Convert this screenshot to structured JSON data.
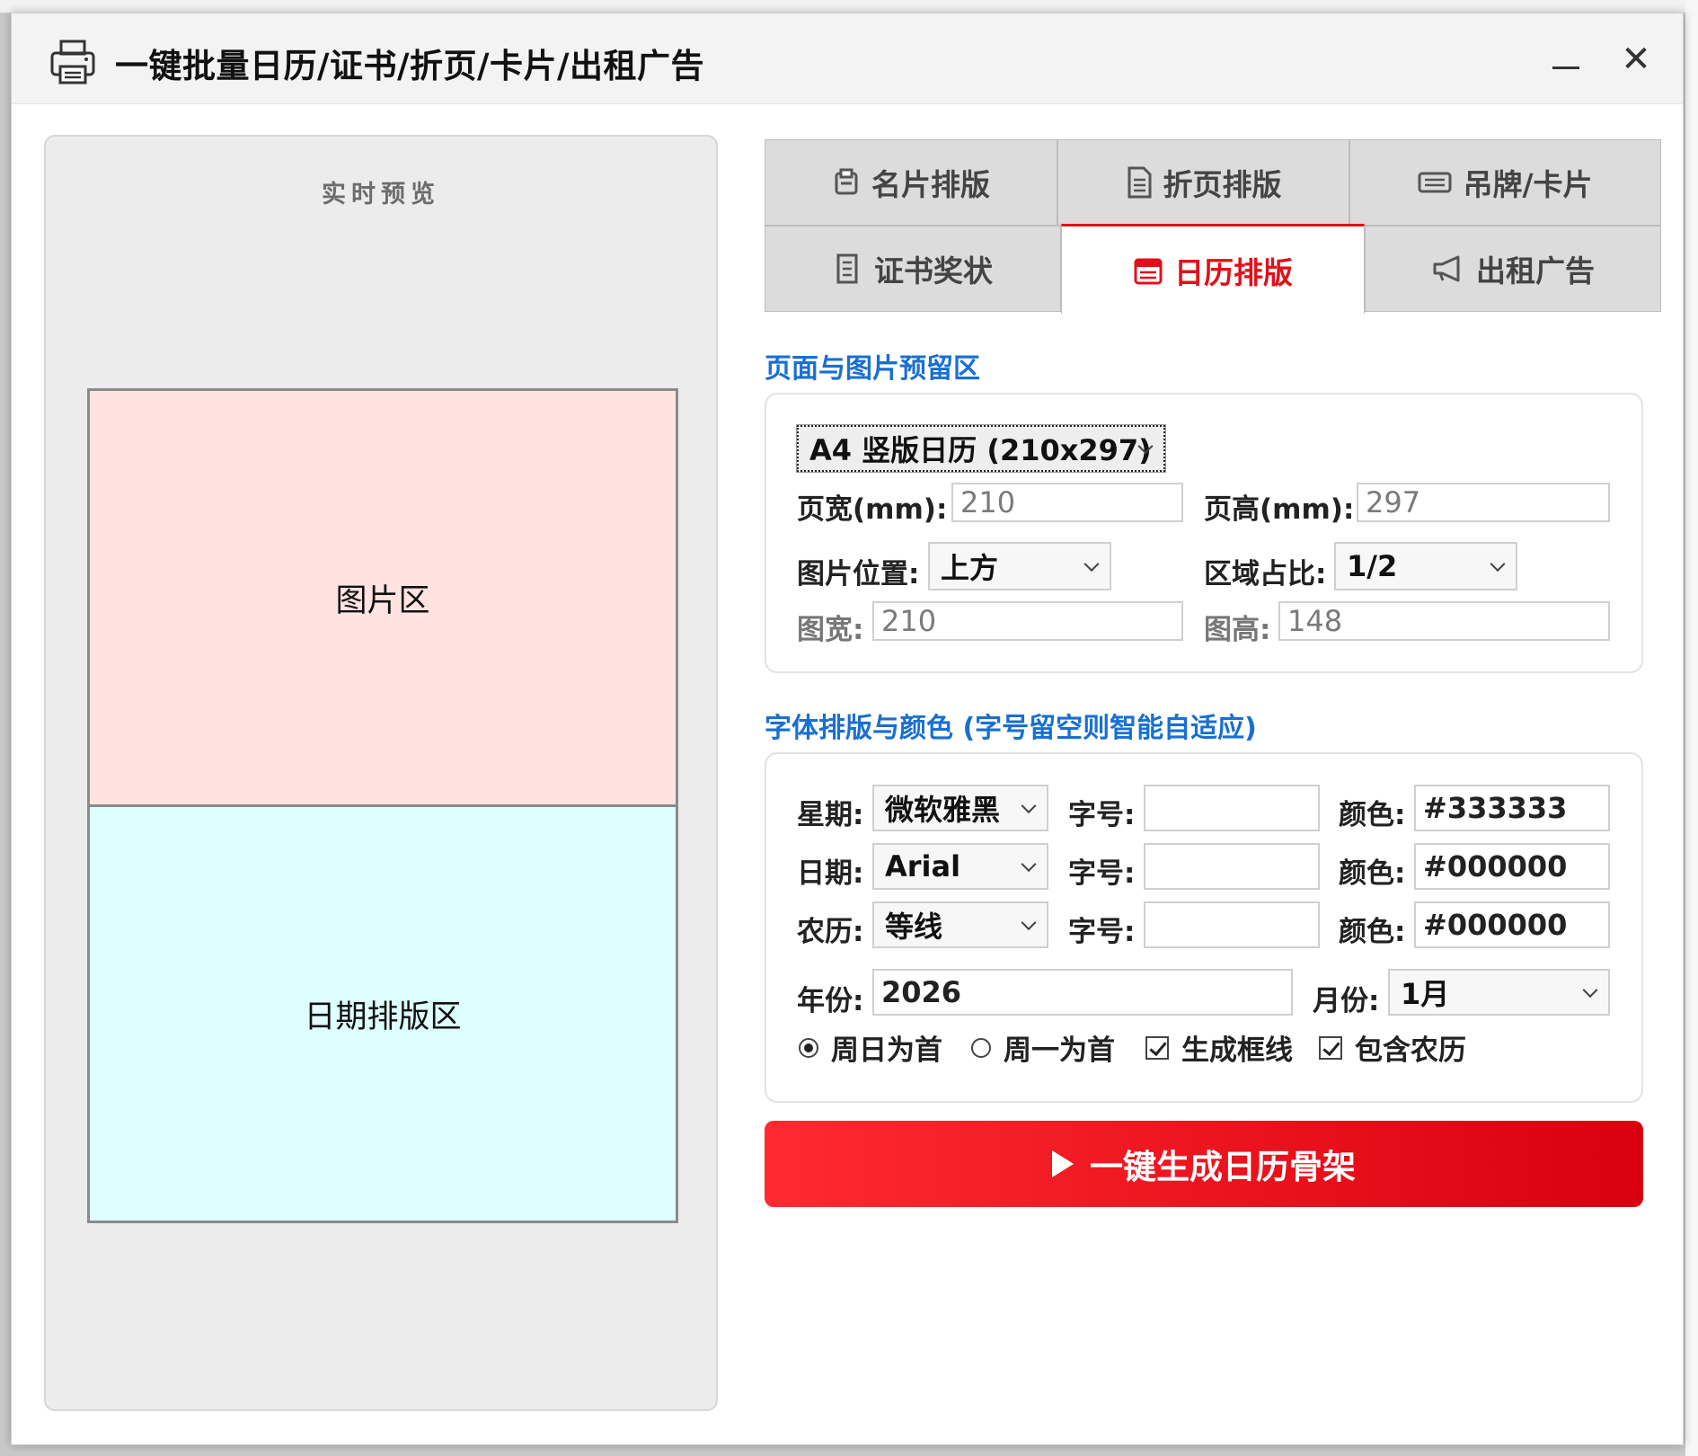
{
  "window": {
    "title": "一键批量日历/证书/折页/卡片/出租广告",
    "minimize_label": "—",
    "close_label": "✕"
  },
  "preview": {
    "label": "实时预览",
    "image_zone_label": "图片区",
    "date_zone_label": "日期排版区",
    "image_zone_fraction": 0.5
  },
  "tabs": {
    "card": "名片排版",
    "fold": "折页排版",
    "tag": "吊牌/卡片",
    "cert": "证书奖状",
    "calendar": "日历排版",
    "rental": "出租广告",
    "active": "calendar"
  },
  "page_section": {
    "title": "页面与图片预留区",
    "preset": "A4 竖版日历 (210x297)",
    "page_width_label": "页宽(mm):",
    "page_width": "210",
    "page_height_label": "页高(mm):",
    "page_height": "297",
    "image_position_label": "图片位置:",
    "image_position": "上方",
    "area_ratio_label": "区域占比:",
    "area_ratio": "1/2",
    "image_width_label": "图宽:",
    "image_width": "210",
    "image_height_label": "图高:",
    "image_height": "148"
  },
  "font_section": {
    "title": "字体排版与颜色 (字号留空则智能自适应)",
    "rows": [
      {
        "label": "星期:",
        "font": "微软雅黑",
        "size_label": "字号:",
        "size": "",
        "color_label": "颜色:",
        "color": "#333333"
      },
      {
        "label": "日期:",
        "font": "Arial",
        "size_label": "字号:",
        "size": "",
        "color_label": "颜色:",
        "color": "#000000"
      },
      {
        "label": "农历:",
        "font": "等线",
        "size_label": "字号:",
        "size": "",
        "color_label": "颜色:",
        "color": "#000000"
      }
    ],
    "year_label": "年份:",
    "year": "2026",
    "month_label": "月份:",
    "month": "1月",
    "opt_sunday_first": "周日为首",
    "opt_monday_first": "周一为首",
    "opt_grid_lines": "生成框线",
    "opt_lunar": "包含农历",
    "sunday_first": true,
    "grid_lines": true,
    "lunar": true
  },
  "generate_button": "一键生成日历骨架",
  "colors": {
    "accent": "#e0101a",
    "section_title": "#1a6fd1",
    "image_zone": "#ffe3e0",
    "date_zone": "#deffff"
  }
}
